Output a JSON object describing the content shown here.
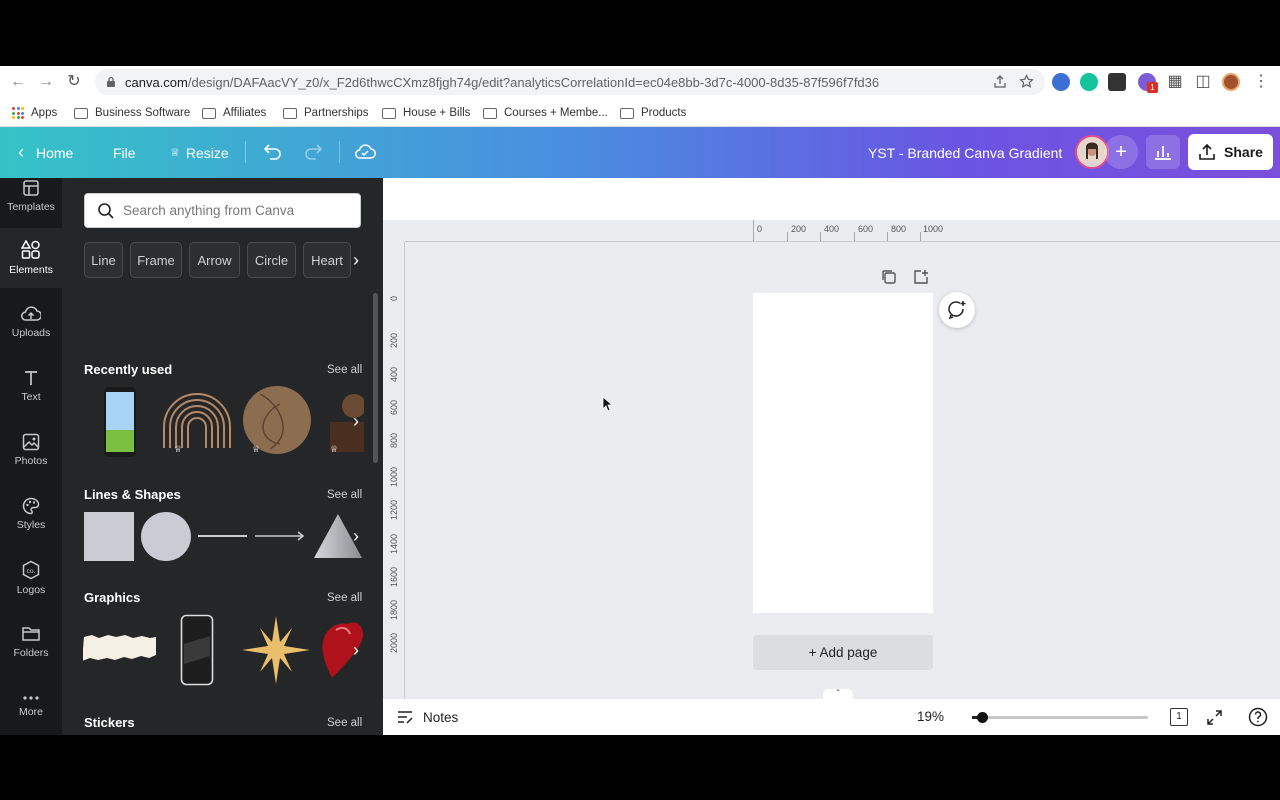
{
  "browser": {
    "url_host": "canva.com",
    "url_path": "/design/DAFAacVY_z0/x_F2d6thwcCXmz8fjgh74g/edit?analyticsCorrelationId=ec04e8bb-3d7c-4000-8d35-87f596f7fd36",
    "bookmarks": [
      "Apps",
      "Business Software",
      "Affiliates",
      "Partnerships",
      "House + Bills",
      "Courses + Membe...",
      "Products"
    ],
    "extension_badge": "1"
  },
  "header": {
    "home": "Home",
    "file": "File",
    "resize": "Resize",
    "design_title": "YST - Branded Canva Gradient",
    "share": "Share",
    "add": "+"
  },
  "rail": {
    "items": [
      {
        "label": "Templates",
        "icon": "templates-icon"
      },
      {
        "label": "Elements",
        "icon": "elements-icon"
      },
      {
        "label": "Uploads",
        "icon": "uploads-icon"
      },
      {
        "label": "Text",
        "icon": "text-icon"
      },
      {
        "label": "Photos",
        "icon": "photos-icon"
      },
      {
        "label": "Styles",
        "icon": "styles-icon"
      },
      {
        "label": "Logos",
        "icon": "logos-icon"
      },
      {
        "label": "Folders",
        "icon": "folders-icon"
      },
      {
        "label": "More",
        "icon": "more-icon"
      }
    ]
  },
  "panel": {
    "search_placeholder": "Search anything from Canva",
    "chips": [
      "Line",
      "Frame",
      "Arrow",
      "Circle",
      "Heart"
    ],
    "see_all": "See all",
    "sections": [
      {
        "title": "Recently used"
      },
      {
        "title": "Lines & Shapes"
      },
      {
        "title": "Graphics"
      },
      {
        "title": "Stickers"
      }
    ]
  },
  "editor": {
    "ruler_h": [
      "0",
      "200",
      "400",
      "600",
      "800",
      "1000"
    ],
    "ruler_v": [
      "0",
      "200",
      "400",
      "600",
      "800",
      "1000",
      "1200",
      "1400",
      "1600",
      "1800",
      "2000"
    ],
    "add_page": "+ Add page"
  },
  "footer": {
    "notes": "Notes",
    "zoom": "19%",
    "zoom_level": 0.19,
    "page_count": "1"
  }
}
